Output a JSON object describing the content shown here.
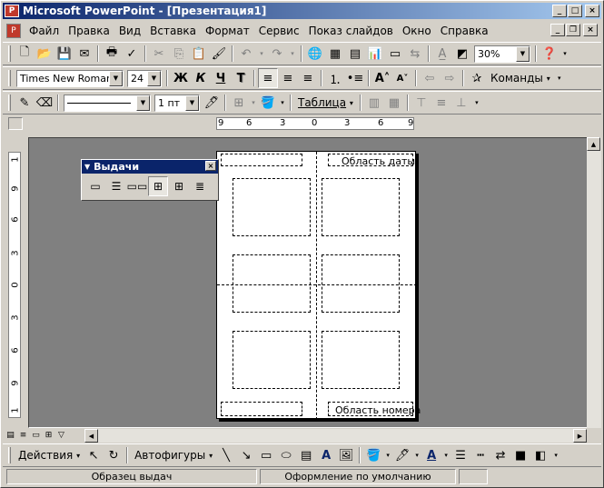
{
  "window": {
    "title": "Microsoft PowerPoint - [Презентация1]",
    "app_icon": "powerpoint-icon"
  },
  "menu": {
    "items": [
      "Файл",
      "Правка",
      "Вид",
      "Вставка",
      "Формат",
      "Сервис",
      "Показ слайдов",
      "Окно",
      "Справка"
    ]
  },
  "toolbar_standard": {
    "zoom": "30%"
  },
  "toolbar_formatting": {
    "font_name": "Times New Roman",
    "font_size": "24",
    "bold": "Ж",
    "italic": "К",
    "underline": "Ч",
    "shadow": "Т",
    "commands_label": "Команды"
  },
  "toolbar_tables": {
    "line_weight": "1 пт",
    "table_label": "Таблица"
  },
  "ruler_h": {
    "ticks": [
      "9",
      "6",
      "3",
      "0",
      "3",
      "6",
      "9"
    ]
  },
  "ruler_v": {
    "ticks": [
      "1",
      "9",
      "6",
      "3",
      "0",
      "3",
      "6",
      "9",
      "1"
    ]
  },
  "handouts_toolbar": {
    "title": "Выдачи"
  },
  "page": {
    "date_area": "Область даты",
    "number_area": "Область номера"
  },
  "drawing_toolbar": {
    "actions_label": "Действия",
    "autoshapes_label": "Автофигуры"
  },
  "status": {
    "pane1": "Образец выдач",
    "pane2": "Оформление по умолчанию",
    "pane3": ""
  }
}
